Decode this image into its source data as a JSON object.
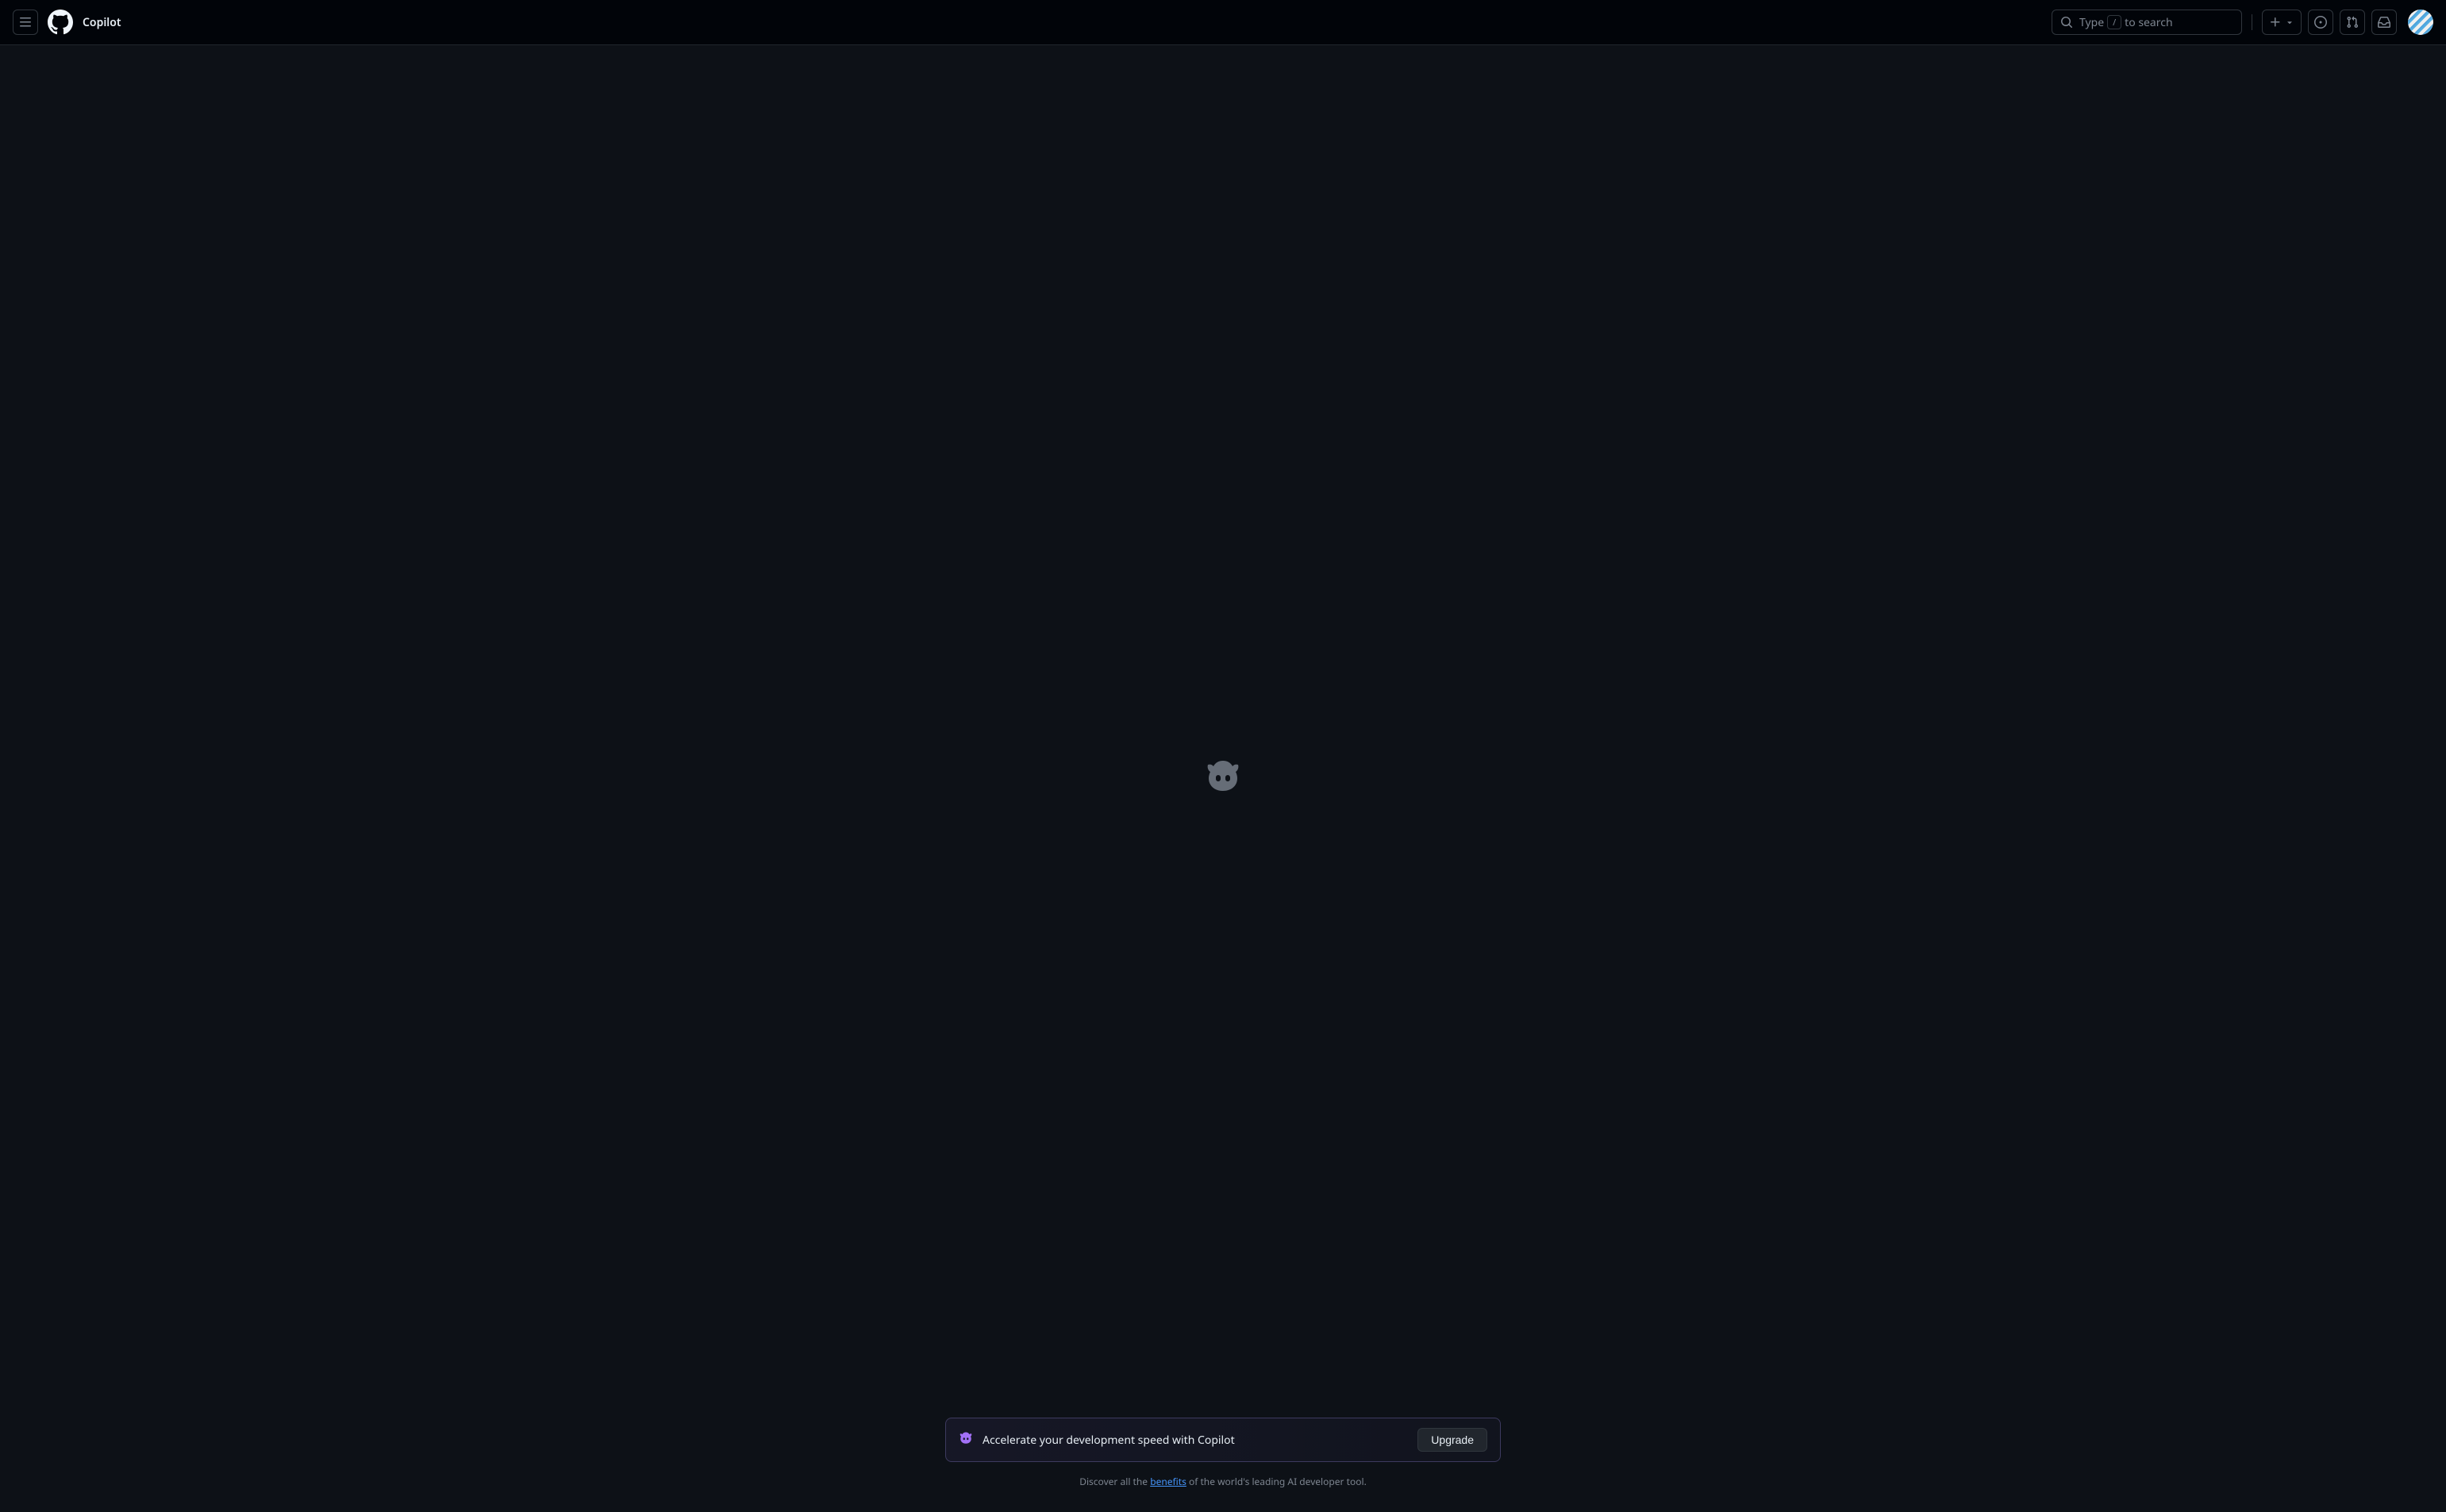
{
  "header": {
    "app_title": "Copilot",
    "search": {
      "prefix": "Type",
      "key": "/",
      "suffix": "to search"
    }
  },
  "promo": {
    "text": "Accelerate your development speed with Copilot",
    "button": "Upgrade"
  },
  "discover": {
    "prefix": "Discover all the ",
    "link": "benefits",
    "suffix": " of the world's leading AI developer tool."
  }
}
